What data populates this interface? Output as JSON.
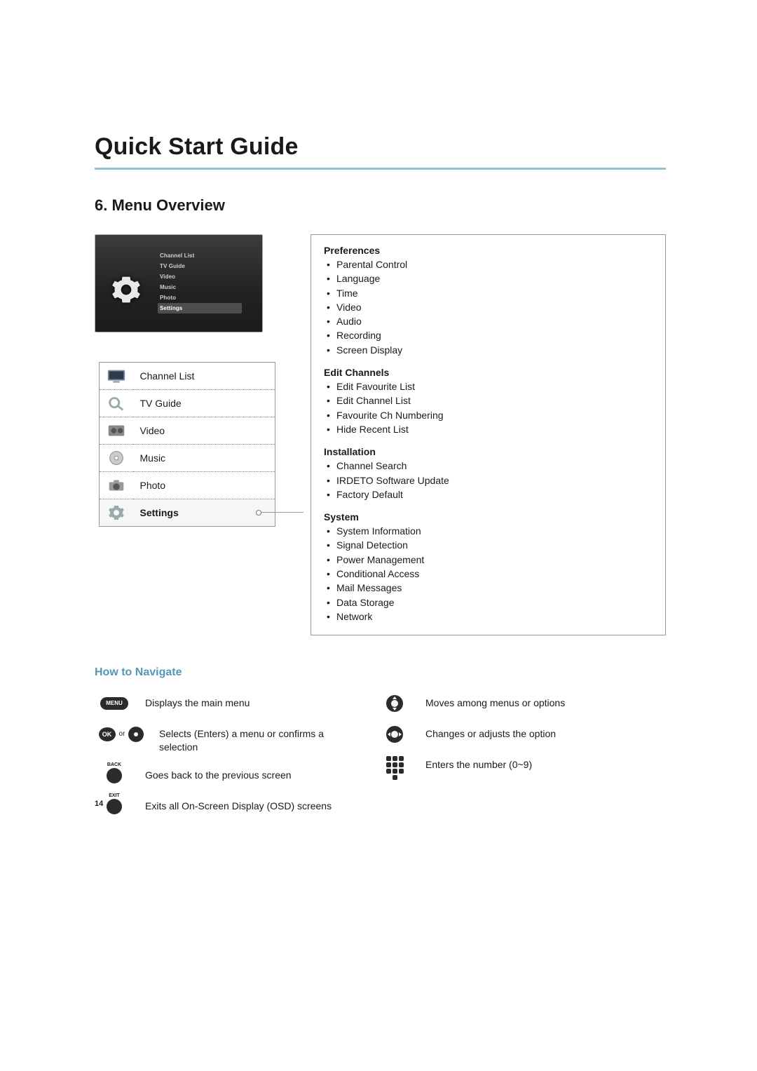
{
  "page_title": "Quick Start Guide",
  "section_title": "6. Menu Overview",
  "screenshot_menu": {
    "items": [
      "Channel List",
      "TV Guide",
      "Video",
      "Music",
      "Photo",
      "Settings"
    ],
    "selected_index": 5
  },
  "menu_table": {
    "rows": [
      {
        "icon": "tv-icon",
        "label": "Channel List",
        "bold": false
      },
      {
        "icon": "search-icon",
        "label": "TV Guide",
        "bold": false
      },
      {
        "icon": "film-icon",
        "label": "Video",
        "bold": false
      },
      {
        "icon": "disc-icon",
        "label": "Music",
        "bold": false
      },
      {
        "icon": "camera-icon",
        "label": "Photo",
        "bold": false
      },
      {
        "icon": "gear-icon",
        "label": "Settings",
        "bold": true
      }
    ]
  },
  "settings": {
    "groups": [
      {
        "title": "Preferences",
        "items": [
          "Parental Control",
          "Language",
          "Time",
          "Video",
          "Audio",
          "Recording",
          "Screen Display"
        ]
      },
      {
        "title": "Edit Channels",
        "items": [
          "Edit Favourite List",
          "Edit Channel List",
          "Favourite Ch Numbering",
          "Hide Recent List"
        ]
      },
      {
        "title": "Installation",
        "items": [
          "Channel Search",
          "IRDETO Software Update",
          "Factory Default"
        ]
      },
      {
        "title": "System",
        "items": [
          "System Information",
          "Signal Detection",
          "Power Management",
          "Conditional Access",
          "Mail Messages",
          "Data Storage",
          "Network"
        ]
      }
    ]
  },
  "how_to_navigate": {
    "heading": "How to Navigate",
    "left": [
      {
        "icon": "menu-button",
        "text": "Displays the main menu"
      },
      {
        "icon": "ok-or-center",
        "text": "Selects (Enters) a menu or confirms a selection",
        "or_label": "or"
      },
      {
        "icon": "back-button",
        "text": "Goes back to the previous screen",
        "small_label": "BACK"
      },
      {
        "icon": "exit-button",
        "text": "Exits all On-Screen Display (OSD) screens",
        "small_label": "EXIT"
      }
    ],
    "right": [
      {
        "icon": "dpad-vertical",
        "text": "Moves among menus or options"
      },
      {
        "icon": "dpad-horizontal",
        "text": "Changes or adjusts the option"
      },
      {
        "icon": "numpad",
        "text": "Enters the number (0~9)"
      }
    ],
    "labels": {
      "menu": "MENU",
      "ok": "OK"
    }
  },
  "page_number": "14"
}
